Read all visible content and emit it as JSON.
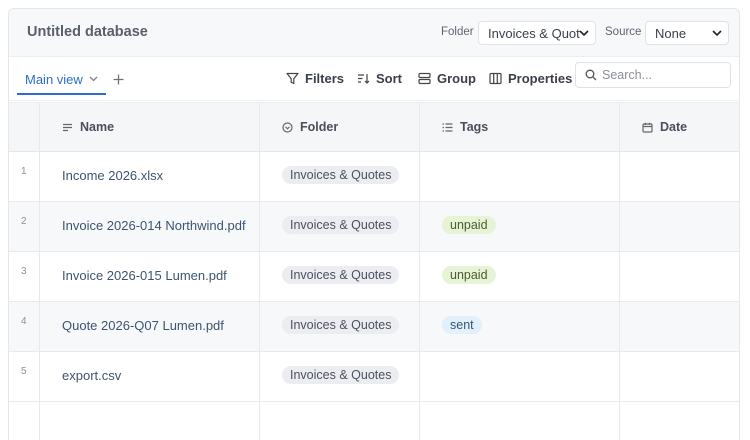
{
  "header": {
    "title": "Untitled database",
    "folder_label": "Folder",
    "folder_value": "Invoices & Quot",
    "source_label": "Source",
    "source_value": "None"
  },
  "toolbar": {
    "view_tab": "Main view",
    "filters": "Filters",
    "sort": "Sort",
    "group": "Group",
    "properties": "Properties",
    "search_placeholder": "Search..."
  },
  "columns": {
    "name": "Name",
    "folder": "Folder",
    "tags": "Tags",
    "date": "Date"
  },
  "rows": [
    {
      "num": "1",
      "name": "Income 2026.xlsx",
      "folder": "Invoices & Quotes",
      "tag": ""
    },
    {
      "num": "2",
      "name": "Invoice 2026-014 Northwind.pdf",
      "folder": "Invoices & Quotes",
      "tag": "unpaid"
    },
    {
      "num": "3",
      "name": "Invoice 2026-015 Lumen.pdf",
      "folder": "Invoices & Quotes",
      "tag": "unpaid"
    },
    {
      "num": "4",
      "name": "Quote 2026-Q07 Lumen.pdf",
      "folder": "Invoices & Quotes",
      "tag": "sent"
    },
    {
      "num": "5",
      "name": "export.csv",
      "folder": "Invoices & Quotes",
      "tag": ""
    }
  ],
  "colors": {
    "accent": "#2d6dcb",
    "tag_unpaid_bg": "#e7f3d7",
    "tag_sent_bg": "#e2f0fb",
    "folder_pill_bg": "#ecedf0"
  }
}
